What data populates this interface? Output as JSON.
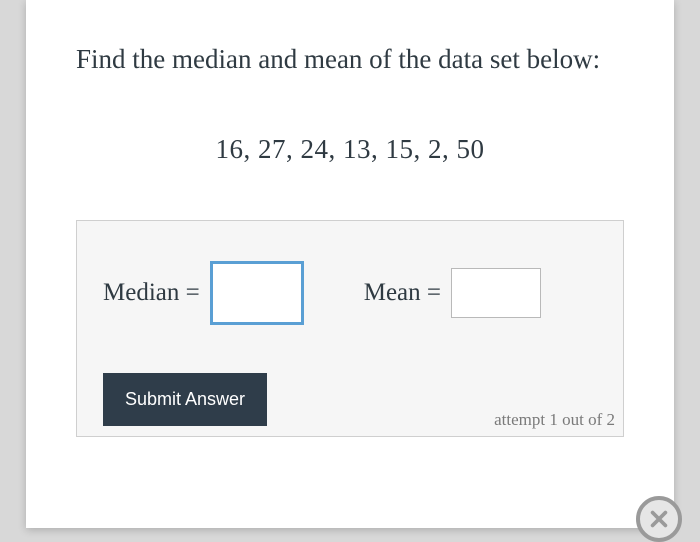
{
  "question": {
    "prompt": "Find the median and mean of the data set below:",
    "data_set_display": "16, 27, 24, 13, 15, 2, 50",
    "data_values": [
      16,
      27,
      24,
      13,
      15,
      2,
      50
    ]
  },
  "answer_panel": {
    "median_label": "Median =",
    "mean_label": "Mean =",
    "median_value": "",
    "mean_value": "",
    "submit_label": "Submit Answer",
    "attempt_text": "attempt 1 out of 2"
  },
  "icons": {
    "close": "close-icon"
  }
}
